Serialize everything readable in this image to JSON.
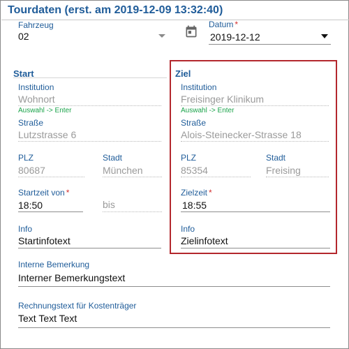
{
  "header": {
    "title": "Tourdaten (erst. am 2019-12-09 13:32:40)"
  },
  "fahrzeug": {
    "label": "Fahrzeug",
    "value": "02"
  },
  "datum": {
    "label": "Datum",
    "required_mark": "*",
    "value": "2019-12-12",
    "icon": "calendar-icon"
  },
  "start": {
    "heading": "Start",
    "institution": {
      "label": "Institution",
      "value": "Wohnort",
      "hint": "Auswahl -> Enter"
    },
    "strasse": {
      "label": "Straße",
      "value": "Lutzstrasse 6"
    },
    "plz": {
      "label": "PLZ",
      "value": "80687"
    },
    "stadt": {
      "label": "Stadt",
      "value": "München"
    },
    "startzeit": {
      "label": "Startzeit von",
      "required_mark": "*",
      "value": "18:50"
    },
    "bis": {
      "value": "bis"
    },
    "info": {
      "label": "Info",
      "value": "Startinfotext"
    }
  },
  "ziel": {
    "heading": "Ziel",
    "institution": {
      "label": "Institution",
      "value": "Freisinger Klinikum",
      "hint": "Auswahl -> Enter"
    },
    "strasse": {
      "label": "Straße",
      "value": "Alois-Steinecker-Strasse 18"
    },
    "plz": {
      "label": "PLZ",
      "value": "85354"
    },
    "stadt": {
      "label": "Stadt",
      "value": "Freising"
    },
    "zielzeit": {
      "label": "Zielzeit",
      "required_mark": "*",
      "value": "18:55"
    },
    "info": {
      "label": "Info",
      "value": "Zielinfotext"
    }
  },
  "interne_bemerkung": {
    "label": "Interne Bemerkung",
    "value": "Interner Bemerkungstext"
  },
  "rechnungstext": {
    "label": "Rechnungstext für Kostenträger",
    "value": "Text Text Text"
  },
  "colors": {
    "primary": "#1f5c99",
    "required": "#d32f2f",
    "hint": "#1aa34a",
    "highlight_border": "#b3272d"
  }
}
